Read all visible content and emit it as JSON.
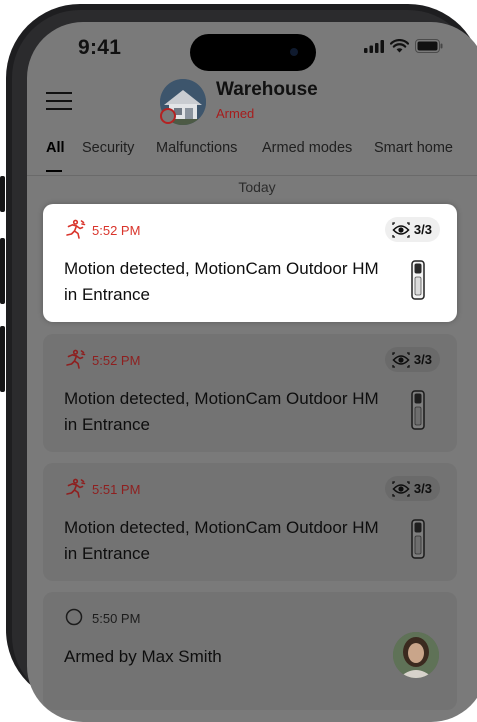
{
  "status_bar": {
    "time": "9:41"
  },
  "header": {
    "site_name": "Warehouse",
    "site_status": "Armed"
  },
  "tabs": [
    {
      "label": "All",
      "active": true
    },
    {
      "label": "Security"
    },
    {
      "label": "Malfunctions"
    },
    {
      "label": "Armed modes"
    },
    {
      "label": "Smart home"
    }
  ],
  "feed": {
    "day_label": "Today",
    "events": [
      {
        "time": "5:52 PM",
        "text": "Motion detected, MotionCam Outdoor HM in Entrance",
        "badge": "3/3",
        "icon": "motion-icon",
        "highlighted": true
      },
      {
        "time": "5:52 PM",
        "text": "Motion detected, MotionCam Outdoor HM in Entrance",
        "badge": "3/3",
        "icon": "motion-icon"
      },
      {
        "time": "5:51 PM",
        "text": "Motion detected, MotionCam Outdoor HM in Entrance",
        "badge": "3/3",
        "icon": "motion-icon"
      },
      {
        "time": "5:50 PM",
        "text": "Armed by Max Smith",
        "icon": "armed-circle-icon"
      }
    ]
  },
  "colors": {
    "alarm_red": "#d9342b",
    "armed_red": "#a61d1d",
    "overlay_gray": "#7a7a7a"
  }
}
